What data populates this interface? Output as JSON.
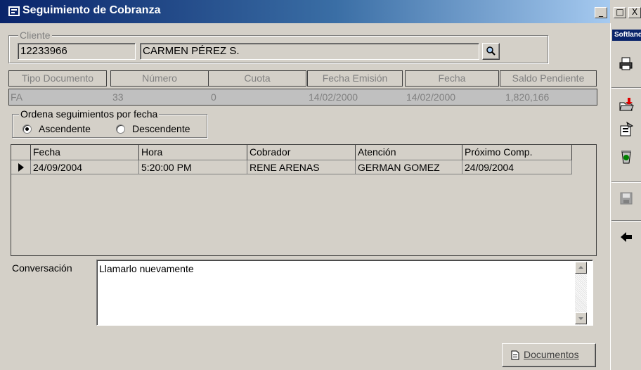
{
  "window": {
    "title": "Seguimiento de Cobranza",
    "minimize": "_",
    "maximize": "□",
    "close": "X"
  },
  "toolbar": {
    "brand": "Softland"
  },
  "cliente": {
    "legend": "Cliente",
    "rut": "12233966",
    "nombre": "CARMEN PÉREZ S."
  },
  "documento": {
    "headers": [
      "Tipo Documento",
      "Número",
      "Cuota",
      "Fecha Emisión",
      "Fecha",
      "Saldo Pendiente"
    ],
    "values": [
      "FA",
      "33",
      "0",
      "14/02/2000",
      "14/02/2000",
      "1,820,166"
    ]
  },
  "orden": {
    "legend": "Ordena seguimientos por fecha",
    "ascendente": "Ascendente",
    "descendente": "Descendente",
    "selected": "Ascendente"
  },
  "grid": {
    "columns": [
      "Fecha",
      "Hora",
      "Cobrador",
      "Atención",
      "Próximo Comp."
    ],
    "rows": [
      [
        "24/09/2004",
        "5:20:00 PM",
        "RENE ARENAS",
        "GERMAN GOMEZ",
        "24/09/2004"
      ]
    ]
  },
  "conversacion": {
    "label": "Conversación",
    "text": "Llamarlo nuevamente"
  },
  "buttons": {
    "documentos": "Documentos"
  }
}
